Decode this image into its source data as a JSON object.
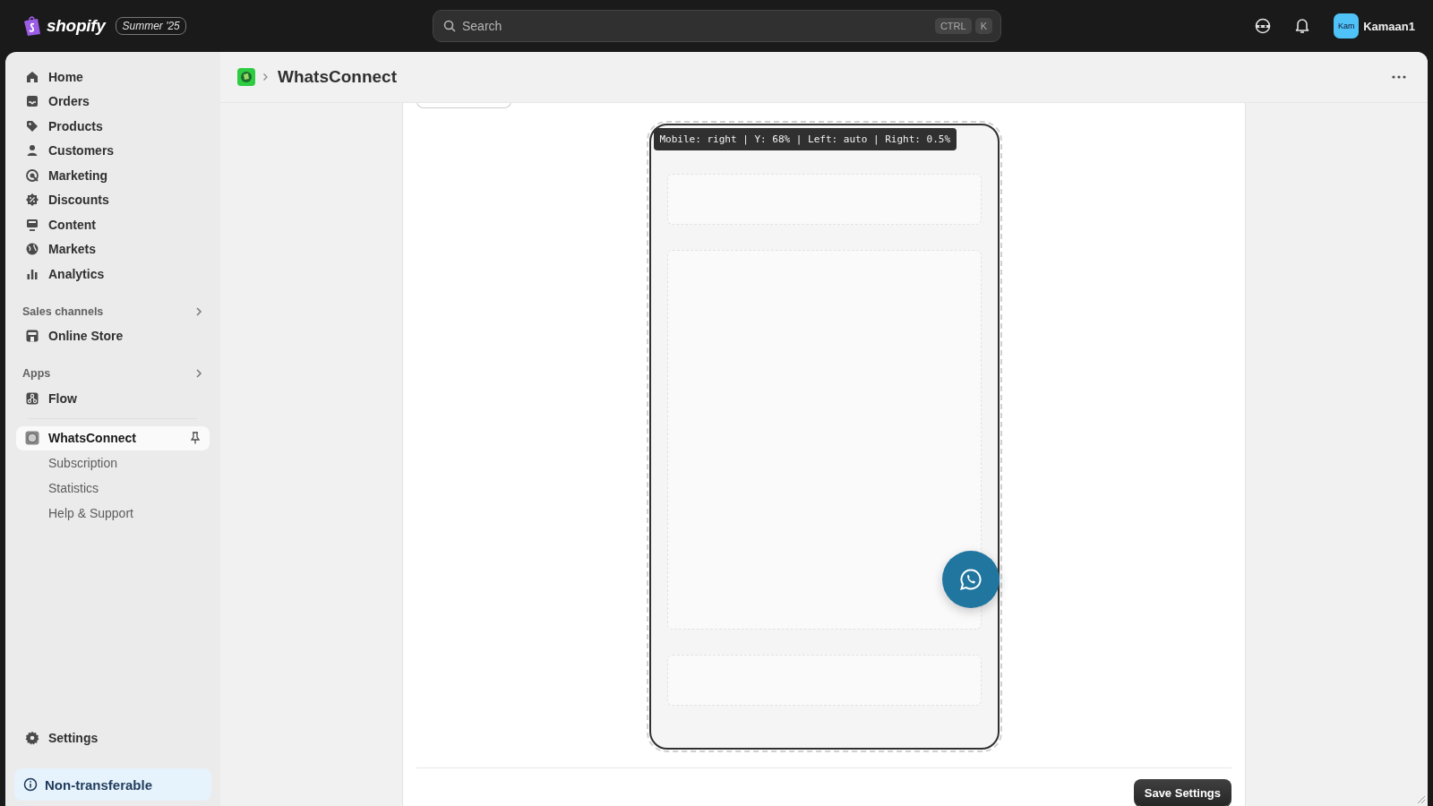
{
  "top_bar": {
    "brand": "shopify",
    "badge": "Summer '25",
    "search": {
      "placeholder": "Search"
    },
    "shortcut_keys": [
      "CTRL",
      "K"
    ],
    "avatar_initials": "Kam",
    "user_name": "Kamaan1"
  },
  "sidebar": {
    "items": [
      {
        "label": "Home",
        "selected": false
      },
      {
        "label": "Orders",
        "selected": false
      },
      {
        "label": "Products",
        "selected": false
      },
      {
        "label": "Customers",
        "selected": false
      },
      {
        "label": "Marketing",
        "selected": false
      },
      {
        "label": "Discounts",
        "selected": false
      },
      {
        "label": "Content",
        "selected": false
      },
      {
        "label": "Markets",
        "selected": false
      },
      {
        "label": "Analytics",
        "selected": false
      }
    ],
    "sections": [
      {
        "title": "Sales channels",
        "items": [
          {
            "label": "Online Store",
            "selected": false
          }
        ]
      },
      {
        "title": "Apps",
        "items": [
          {
            "label": "Flow",
            "selected": false
          }
        ]
      }
    ],
    "app": {
      "label": "WhatsConnect",
      "selected": true,
      "children": [
        {
          "label": "Subscription",
          "selected": false
        },
        {
          "label": "Statistics",
          "selected": false
        },
        {
          "label": "Help & Support",
          "selected": false
        }
      ]
    },
    "settings": "Settings",
    "notice": "Non-transferable"
  },
  "page": {
    "title": "WhatsConnect"
  },
  "preview": {
    "tooltip": "Mobile: right | Y: 68% | Left: auto | Right: 0.5%"
  },
  "save_button": "Save Settings"
}
